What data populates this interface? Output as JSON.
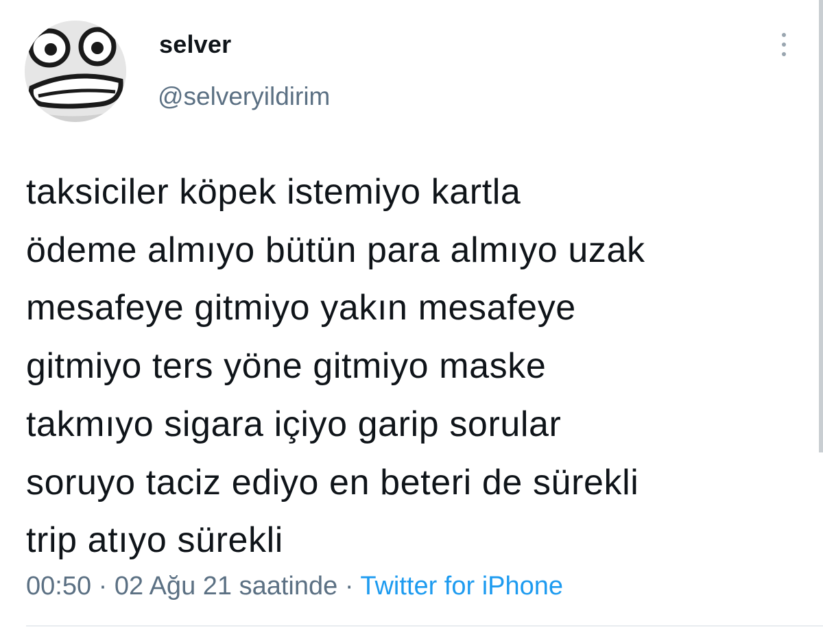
{
  "tweet": {
    "user": {
      "display_name": "selver",
      "handle": "@selveryildirim",
      "avatar_icon": "cartoon-face-avatar"
    },
    "text": "taksiciler köpek istemiyo kartla\nödeme almıyo bütün para almıyo uzak\nmesafeye gitmiyo yakın mesafeye\ngitmiyo ters yöne gitmiyo maske\ntakmıyo sigara içiyo garip sorular\nsoruyo taciz ediyo en beteri de sürekli\ntrip atıyo sürekli",
    "meta": {
      "time_date": "00:50 · 02 Ağu 21 saatinde · ",
      "source": "Twitter for iPhone"
    },
    "menu_icon": "more-vertical-icon"
  },
  "colors": {
    "text": "#0f1419",
    "secondary": "#5b7083",
    "link": "#1d9bf0"
  }
}
